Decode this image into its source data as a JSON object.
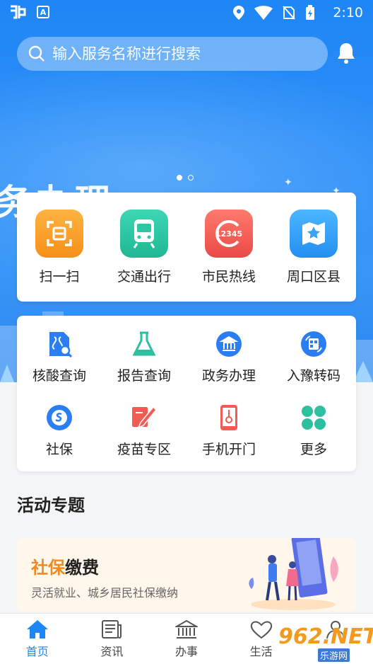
{
  "status_bar": {
    "time": "2:10",
    "left_icons": [
      "app-logo-icon",
      "a-badge-icon"
    ],
    "right_icons": [
      "location-icon",
      "wifi-icon",
      "no-sim-icon",
      "battery-icon"
    ],
    "badge_letter": "A"
  },
  "search": {
    "placeholder": "输入服务名称进行搜索"
  },
  "banner": {
    "big_text": "务办理",
    "slide_count": 2,
    "active_slide": 0
  },
  "quick_services": [
    {
      "label": "扫一扫",
      "icon": "scan-icon",
      "color": "#f7a028"
    },
    {
      "label": "交通出行",
      "icon": "train-icon",
      "color": "#2cc6a3"
    },
    {
      "label": "市民热线",
      "icon": "hotline-12345-icon",
      "color": "#f15b53",
      "icon_text": "12345"
    },
    {
      "label": "周口区县",
      "icon": "map-icon",
      "color": "#3aa3f5"
    }
  ],
  "services": [
    {
      "label": "核酸查询",
      "icon": "nucleic-test-icon",
      "color": "#2b7df2"
    },
    {
      "label": "报告查询",
      "icon": "flask-icon",
      "color": "#2cbfa0"
    },
    {
      "label": "政务办理",
      "icon": "government-icon",
      "color": "#2b7df2"
    },
    {
      "label": "入豫转码",
      "icon": "qr-transfer-icon",
      "color": "#2b7df2"
    },
    {
      "label": "社保",
      "icon": "social-security-icon",
      "color": "#2b7df2"
    },
    {
      "label": "疫苗专区",
      "icon": "vaccine-icon",
      "color": "#f15b53"
    },
    {
      "label": "手机开门",
      "icon": "phone-key-icon",
      "color": "#f15b53"
    },
    {
      "label": "更多",
      "icon": "more-grid-icon",
      "color": "#2cbfa0"
    }
  ],
  "activities": {
    "title": "活动专题",
    "promo": {
      "title_accent": "社保",
      "title_rest": "缴费",
      "subtitle": "灵活就业、城乡居民社保缴纳"
    }
  },
  "tabs": [
    {
      "label": "首页",
      "icon": "home-icon",
      "active": true
    },
    {
      "label": "资讯",
      "icon": "news-icon",
      "active": false
    },
    {
      "label": "办事",
      "icon": "bank-icon",
      "active": false
    },
    {
      "label": "生活",
      "icon": "heart-icon",
      "active": false
    },
    {
      "label": "",
      "icon": "user-icon",
      "active": false
    }
  ],
  "watermark": {
    "text": "962.NET",
    "sub": "乐游网"
  }
}
